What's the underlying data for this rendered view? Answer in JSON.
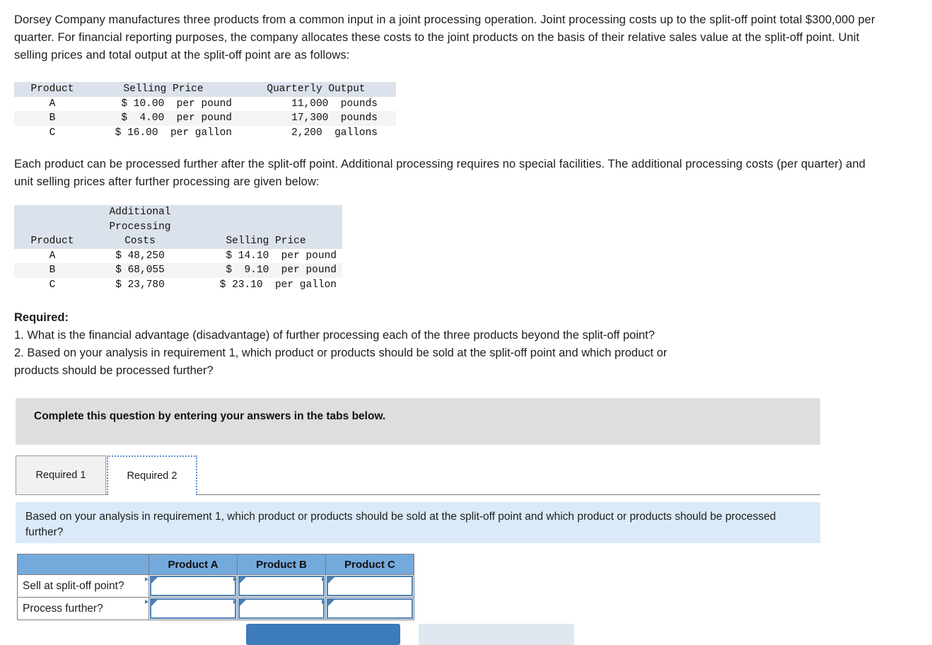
{
  "intro": {
    "paragraph": "Dorsey Company manufactures three products from a common input in a joint processing operation. Joint processing costs up to the split-off point total $300,000 per quarter. For financial reporting purposes, the company allocates these costs to the joint products on the basis of their relative sales value at the split-off point. Unit selling prices and total output at the split-off point are as follows:",
    "paragraph2": "Each product can be processed further after the split-off point. Additional processing requires no special facilities. The additional processing costs (per quarter) and unit selling prices after further processing are given below:"
  },
  "table_split_off": {
    "headers": {
      "product": "Product",
      "selling_price": "Selling Price",
      "quarterly_output": "Quarterly Output"
    },
    "rows": [
      {
        "product": "A",
        "selling_price": "$ 10.00  per pound",
        "quarterly_output": "11,000  pounds"
      },
      {
        "product": "B",
        "selling_price": "$  4.00  per pound",
        "quarterly_output": "17,300  pounds"
      },
      {
        "product": "C",
        "selling_price": "$ 16.00  per gallon",
        "quarterly_output": "2,200  gallons"
      }
    ]
  },
  "table_further": {
    "headers": {
      "product": "Product",
      "costs_line1": "Additional",
      "costs_line2": "Processing",
      "costs_line3": "Costs",
      "selling_price": "Selling Price"
    },
    "rows": [
      {
        "product": "A",
        "cost": "$ 48,250",
        "selling_price": "$ 14.10  per pound"
      },
      {
        "product": "B",
        "cost": "$ 68,055",
        "selling_price": "$  9.10  per pound"
      },
      {
        "product": "C",
        "cost": "$ 23,780",
        "selling_price": "$ 23.10  per gallon"
      }
    ]
  },
  "required": {
    "heading": "Required:",
    "item1": "1. What is the financial advantage (disadvantage) of further processing each of the three products beyond the split-off point?",
    "item2_line1": "2. Based on your analysis in requirement 1, which product or products should be sold at the split-off point and which product or",
    "item2_line2": "products should be processed further?"
  },
  "instruction_banner": {
    "text": "Complete this question by entering your answers in the tabs below."
  },
  "tabs": [
    {
      "label": "Required 1",
      "active": false
    },
    {
      "label": "Required 2",
      "active": true
    }
  ],
  "question_panel": {
    "line1": "Based on your analysis in requirement 1, which product or products should be sold at the split-off point and which product or",
    "line2": "products should be processed further?"
  },
  "answer_table": {
    "column_headers": [
      "",
      "Product A",
      "Product B",
      "Product C"
    ],
    "rows": [
      {
        "label": "Sell at split-off point?",
        "values": [
          "",
          "",
          ""
        ]
      },
      {
        "label": "Process further?",
        "values": [
          "",
          "",
          ""
        ]
      }
    ]
  },
  "buttons": {
    "prev": "",
    "next": ""
  },
  "colors": {
    "table_header_blue": "#74a9dc",
    "question_panel_blue": "#daeaf8",
    "instruction_gray": "#dedede",
    "mono_header_bg": "#dce2eb",
    "primary_button": "#3d7cba",
    "secondary_button": "#dfe7ef",
    "select_border": "#4a7fb5"
  }
}
